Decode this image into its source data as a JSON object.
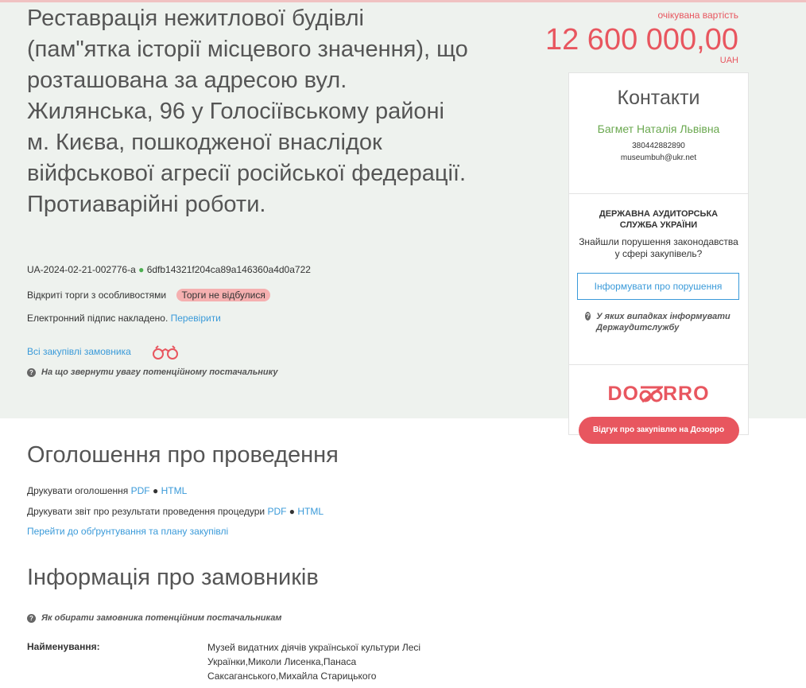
{
  "tender": {
    "title": "Реставрація нежитлової будівлі (пам\"ятка історії місцевого значення), що розташована за адресою вул. Жилянська, 96 у Голосіївському районі м. Києва, пошкодженої внаслідок війфськової агресії російської федерації. Протиаварійні роботи.",
    "id": "UA-2024-02-21-002776-a",
    "hash": "6dfb14321f204ca89a146360a4d0a722",
    "procedure": "Відкриті торги з особливостями",
    "status": "Торги не відбулися",
    "signature_text": "Електронний підпис накладено.",
    "signature_link": "Перевірити",
    "all_purchases": "Всі закупівлі замовника",
    "attention_note": "На що звернути увагу потенційному постачальнику"
  },
  "price": {
    "label": "очікувана вартість",
    "value": "12 600 000,00",
    "currency": "UAH"
  },
  "contacts": {
    "title": "Контакти",
    "name": "Багмет Наталія Львівна",
    "phone": "380442882890",
    "email": "museumbuh@ukr.net"
  },
  "dasu": {
    "title": "ДЕРЖАВНА АУДИТОРСЬКА СЛУЖБА УКРАЇНИ",
    "question": "Знайшли порушення законодавства у сфері закупівель?",
    "button": "Інформувати про порушення",
    "note": "У яких випадках інформувати Держаудитслужбу"
  },
  "dozorro": {
    "logo_prefix": "DO",
    "logo_suffix": "RRO",
    "button": "Відгук про закупівлю на Дозорро"
  },
  "announcement": {
    "title": "Оголошення про проведення",
    "print_notice": "Друкувати оголошення",
    "print_report": "Друкувати звіт про результати проведення процедури",
    "pdf": "PDF",
    "html": "HTML",
    "plan_link": "Перейти до обґрунтування та плану закупівлі"
  },
  "customers": {
    "title": "Інформація про замовників",
    "note": "Як обирати замовника потенційним постачальникам",
    "name_label": "Найменування:",
    "name_value": "Музей видатних діячів української культури Лесі Українки,Миколи Лисенка,Панаса Саксаганського,Михайла Старицького"
  },
  "colors": {
    "accent_red": "#e8565f",
    "link_blue": "#3a9ad9",
    "contact_green": "#6aa84f",
    "hero_bg": "#eef2ee"
  },
  "icons": {
    "binocular": "binoculars-icon",
    "question": "question-circle-icon"
  }
}
